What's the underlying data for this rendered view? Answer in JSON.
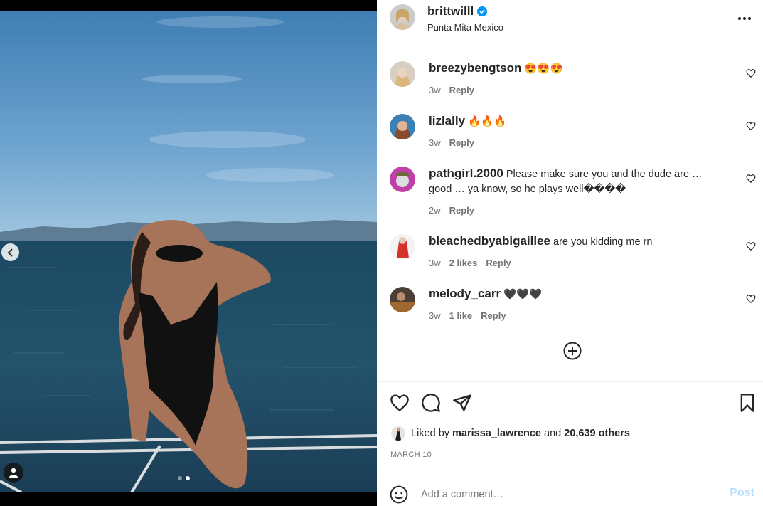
{
  "post": {
    "username": "brittwilll",
    "location": "Punta Mita Mexico",
    "verified_icon": "verified-badge-icon",
    "more_icon": "more-options-icon"
  },
  "comments": [
    {
      "user": "breezybengtson",
      "text": "😍😍😍",
      "time": "3w",
      "likes": "",
      "reply": "Reply"
    },
    {
      "user": "lizlally",
      "text": "🔥🔥🔥",
      "time": "3w",
      "likes": "",
      "reply": "Reply"
    },
    {
      "user": "pathgirl.2000",
      "text": "Please make sure you and the dude are … good … ya know, so he plays well����",
      "time": "2w",
      "likes": "",
      "reply": "Reply"
    },
    {
      "user": "bleachedbyabigaillee",
      "text": "are you kidding me rn",
      "time": "3w",
      "likes": "2 likes",
      "reply": "Reply"
    },
    {
      "user": "melody_carr",
      "text": "🖤🖤🖤",
      "time": "3w",
      "likes": "1 like",
      "reply": "Reply"
    }
  ],
  "liked_by": {
    "prefix": "Liked by",
    "user": "marissa_lawrence",
    "middle": "and",
    "others": "20,639 others"
  },
  "date": "MARCH 10",
  "composer": {
    "placeholder": "Add a comment…",
    "post_label": "Post"
  },
  "carousel": {
    "count": 2,
    "active_index": 1
  },
  "colors": {
    "link_blue": "#0095f6",
    "post_disabled": "#b2dffc",
    "muted": "#737373"
  }
}
